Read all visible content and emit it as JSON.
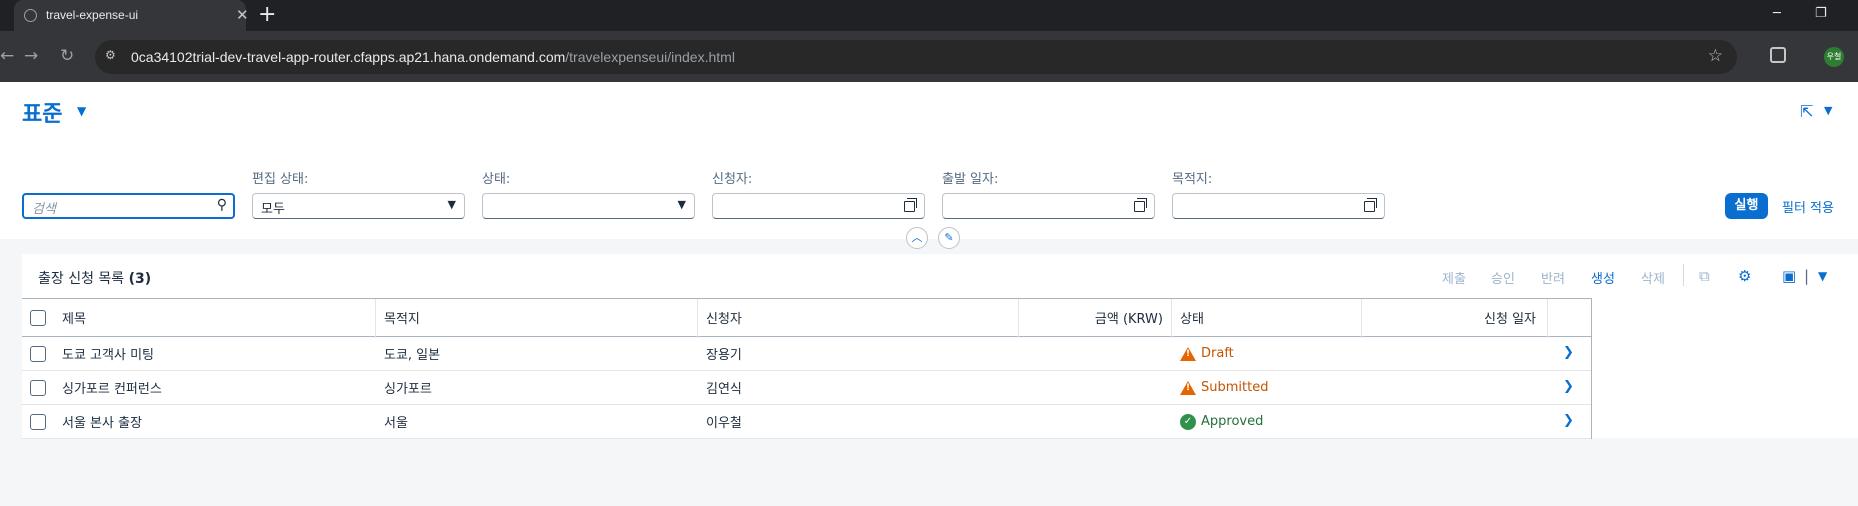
{
  "browser": {
    "tab_title": "travel-expense-ui",
    "tab_close": "✕",
    "new_tab": "+",
    "url_host": "0ca34102trial-dev-travel-app-router.cfapps.ap21.hana.ondemand.com",
    "url_path": "/travelexpenseui/index.html",
    "profile_initials": "우철",
    "win_min": "─",
    "win_restore": "❐",
    "win_close": "✕"
  },
  "header": {
    "variant": "표준"
  },
  "filters": {
    "search_placeholder": "검색",
    "edit_state": {
      "label": "편집 상태:",
      "value": "모두"
    },
    "status": {
      "label": "상태:",
      "value": ""
    },
    "requester": {
      "label": "신청자:",
      "value": ""
    },
    "departure_date": {
      "label": "출발 일자:",
      "value": ""
    },
    "destination": {
      "label": "목적지:",
      "value": ""
    },
    "go_label": "실행",
    "adapt_label": "필터 적용"
  },
  "table": {
    "title": "출장 신청 목록",
    "count": "(3)",
    "toolbar": {
      "submit": "제출",
      "approve": "승인",
      "reject": "반려",
      "create": "생성",
      "delete": "삭제"
    },
    "columns": {
      "title": "제목",
      "destination": "목적지",
      "requester": "신청자",
      "amount": "금액 (KRW)",
      "status": "상태",
      "request_date": "신청 일자"
    },
    "rows": [
      {
        "title": "도쿄 고객사 미팅",
        "destination": "도쿄, 일본",
        "requester": "장용기",
        "amount": "",
        "status": "Draft",
        "request_date": ""
      },
      {
        "title": "싱가포르 컨퍼런스",
        "destination": "싱가포르",
        "requester": "김연식",
        "amount": "",
        "status": "Submitted",
        "request_date": ""
      },
      {
        "title": "서울 본사 출장",
        "destination": "서울",
        "requester": "이우철",
        "amount": "",
        "status": "Approved",
        "request_date": ""
      }
    ]
  },
  "colors": {
    "brand": "#0a6ed1",
    "warning": "#e76500",
    "success": "#30914c"
  }
}
